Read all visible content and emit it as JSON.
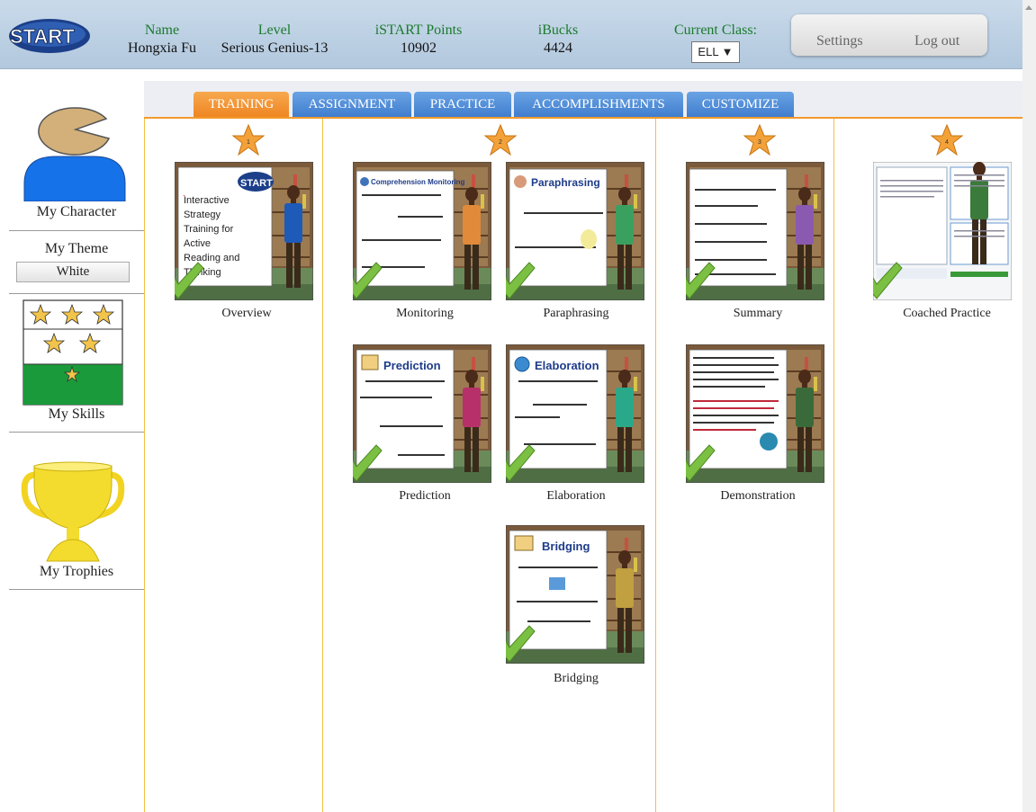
{
  "header": {
    "logo_text": "START",
    "name_label": "Name",
    "name_value": "Hongxia Fu",
    "level_label": "Level",
    "level_value": "Serious Genius-13",
    "points_label": "iSTART Points",
    "points_value": "10902",
    "ibucks_label": "iBucks",
    "ibucks_value": "4424",
    "class_label": "Current Class:",
    "class_value": "ELL ▼",
    "settings_label": "Settings",
    "logout_label": "Log out"
  },
  "sidebar": {
    "character_label": "My Character",
    "theme_label": "My Theme",
    "theme_value": "White",
    "skills_label": "My Skills",
    "trophies_label": "My Trophies"
  },
  "tabs": [
    {
      "label": "TRAINING",
      "active": true
    },
    {
      "label": "ASSIGNMENT",
      "active": false
    },
    {
      "label": "PRACTICE",
      "active": false
    },
    {
      "label": "ACCOMPLISHMENTS",
      "active": false
    },
    {
      "label": "CUSTOMIZE",
      "active": false
    }
  ],
  "columns": [
    {
      "step": "1",
      "modules": [
        {
          "title": "Overview"
        }
      ]
    },
    {
      "step": "2",
      "modules": [
        {
          "title": "Monitoring"
        },
        {
          "title": "Paraphrasing"
        },
        {
          "title": "Prediction"
        },
        {
          "title": "Elaboration"
        },
        {
          "title": "Bridging"
        }
      ]
    },
    {
      "step": "3",
      "modules": [
        {
          "title": "Summary"
        },
        {
          "title": "Demonstration"
        }
      ]
    },
    {
      "step": "4",
      "modules": [
        {
          "title": "Coached Practice"
        }
      ]
    }
  ],
  "slides": {
    "overview_lines": [
      "Interactive",
      "Strategy",
      "Training for",
      "Active",
      "Reading and",
      "Thinking"
    ],
    "overview_logo": "START",
    "monitoring_heading": "Comprehension Monitoring",
    "paraphrasing_heading": "Paraphrasing",
    "prediction_heading": "Prediction",
    "elaboration_heading": "Elaboration",
    "bridging_heading": "Bridging"
  },
  "colors": {
    "accent_orange": "#ee8420",
    "tab_blue": "#3e7ccd",
    "label_green": "#1b7a2c",
    "check_green": "#7cc043",
    "star_gold": "#f3a23a"
  }
}
